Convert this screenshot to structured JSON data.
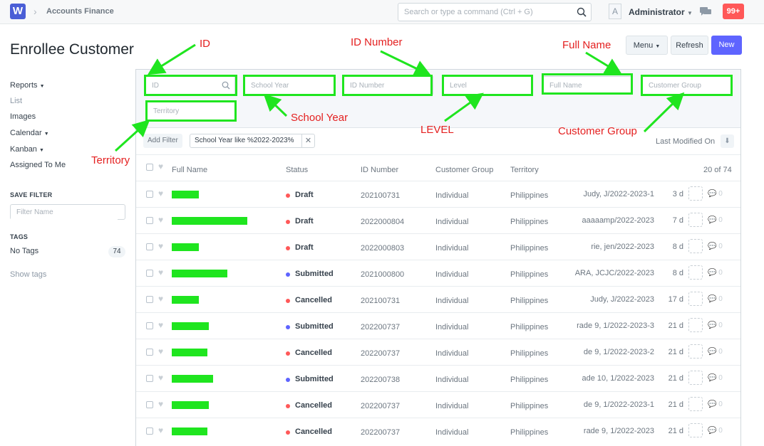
{
  "navbar": {
    "logo": "W",
    "breadcrumb": "Accounts Finance",
    "search_placeholder": "Search or type a command (Ctrl + G)",
    "avatar_initial": "A",
    "user": "Administrator",
    "notifications": "99+"
  },
  "page": {
    "title": "Enrollee Customer",
    "menu_label": "Menu",
    "refresh_label": "Refresh",
    "new_label": "New"
  },
  "sidebar": {
    "links": [
      "Reports",
      "List",
      "Images",
      "Calendar",
      "Kanban",
      "Assigned To Me"
    ],
    "save_filter_heading": "SAVE FILTER",
    "filter_name_placeholder": "Filter Name",
    "tags_heading": "TAGS",
    "no_tags": "No Tags",
    "tag_count": "74",
    "show_tags": "Show tags"
  },
  "filters": {
    "id": "ID",
    "school_year": "School Year",
    "id_number": "ID Number",
    "level": "Level",
    "full_name": "Full Name",
    "customer_group": "Customer Group",
    "territory": "Territory",
    "add_filter": "Add Filter",
    "active_filter": "School Year like %2022-2023%",
    "sort_label": "Last Modified On"
  },
  "table": {
    "headers": {
      "full_name": "Full Name",
      "status": "Status",
      "id_number": "ID Number",
      "customer_group": "Customer Group",
      "territory": "Territory",
      "count": "20 of 74"
    },
    "rows": [
      {
        "status": "Draft",
        "status_color": "#ff5858",
        "id_number": "202100731",
        "group": "Individual",
        "territory": "Philippines",
        "owner": "Judy, J/2022-2023-1",
        "age": "3 d",
        "comments": "0",
        "name_width": 38
      },
      {
        "status": "Draft",
        "status_color": "#ff5858",
        "id_number": "2022000804",
        "group": "Individual",
        "territory": "Philippines",
        "owner": "aaaaamp/2022-2023",
        "age": "7 d",
        "comments": "0",
        "name_width": 106
      },
      {
        "status": "Draft",
        "status_color": "#ff5858",
        "id_number": "2022000803",
        "group": "Individual",
        "territory": "Philippines",
        "owner": "rie, jen/2022-2023",
        "age": "8 d",
        "comments": "0",
        "name_width": 38
      },
      {
        "status": "Submitted",
        "status_color": "#5e64ff",
        "id_number": "2021000800",
        "group": "Individual",
        "territory": "Philippines",
        "owner": "ARA, JCJC/2022-2023",
        "age": "8 d",
        "comments": "0",
        "name_width": 78
      },
      {
        "status": "Cancelled",
        "status_color": "#ff5858",
        "id_number": "202100731",
        "group": "Individual",
        "territory": "Philippines",
        "owner": "Judy, J/2022-2023",
        "age": "17 d",
        "comments": "0",
        "name_width": 38
      },
      {
        "status": "Submitted",
        "status_color": "#5e64ff",
        "id_number": "202200737",
        "group": "Individual",
        "territory": "Philippines",
        "owner": "rade 9, 1/2022-2023-3",
        "age": "21 d",
        "comments": "0",
        "name_width": 52
      },
      {
        "status": "Cancelled",
        "status_color": "#ff5858",
        "id_number": "202200737",
        "group": "Individual",
        "territory": "Philippines",
        "owner": "de 9, 1/2022-2023-2",
        "age": "21 d",
        "comments": "0",
        "name_width": 50
      },
      {
        "status": "Submitted",
        "status_color": "#5e64ff",
        "id_number": "202200738",
        "group": "Individual",
        "territory": "Philippines",
        "owner": "ade 10, 1/2022-2023",
        "age": "21 d",
        "comments": "0",
        "name_width": 58
      },
      {
        "status": "Cancelled",
        "status_color": "#ff5858",
        "id_number": "202200737",
        "group": "Individual",
        "territory": "Philippines",
        "owner": "de 9, 1/2022-2023-1",
        "age": "21 d",
        "comments": "0",
        "name_width": 52
      },
      {
        "status": "Cancelled",
        "status_color": "#ff5858",
        "id_number": "202200737",
        "group": "Individual",
        "territory": "Philippines",
        "owner": "rade 9, 1/2022-2023",
        "age": "21 d",
        "comments": "0",
        "name_width": 50
      }
    ]
  },
  "annotations": {
    "id": "ID",
    "id_number": "ID Number",
    "full_name": "Full Name",
    "school_year": "School Year",
    "level": "LEVEL",
    "customer_group": "Customer Group",
    "territory": "Territory",
    "highlight_color": "#1fe51f",
    "label_color": "#e42020"
  }
}
